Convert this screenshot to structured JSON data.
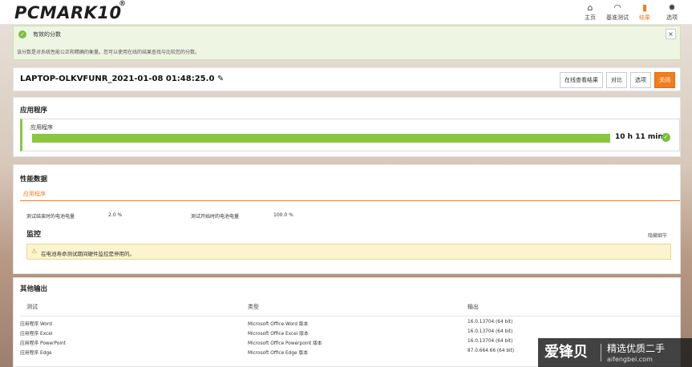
{
  "app": {
    "logo_text": "PCMARK",
    "logo_suffix": "10",
    "logo_sup": "®"
  },
  "nav": [
    {
      "label": "主页",
      "icon": "home-icon",
      "glyph": "⌂"
    },
    {
      "label": "基准测试",
      "icon": "gauge-icon",
      "glyph": "◠"
    },
    {
      "label": "结果",
      "icon": "bar-chart-icon",
      "glyph": "▮",
      "active": true
    },
    {
      "label": "选项",
      "icon": "gear-icon",
      "glyph": "✹"
    }
  ],
  "banner": {
    "title": "有效的分数",
    "description": "该分数是对系统性能公正和精确的衡量。您可以使用在线的结果查找与比较您的分数。",
    "close": "×"
  },
  "run": {
    "name": "LAPTOP-OLKVFUNR_2021-01-08 01:48:25.0",
    "edit_glyph": "✎",
    "buttons": [
      "在线查看结果",
      "对比",
      "选项",
      "关闭"
    ]
  },
  "application": {
    "section_title": "应用程序",
    "score_label": "应用程序",
    "score_value": "10 h 11 min",
    "progress_fraction": 1.0,
    "accent_color": "#8cc63f"
  },
  "performance": {
    "section_title": "性能数据",
    "tab": "应用程序",
    "kv": [
      {
        "label": "测试结束时的电池电量",
        "value": "2.0 %"
      },
      {
        "label": "测试开始时的电池电量",
        "value": "100.0 %"
      }
    ],
    "monitor_title": "监控",
    "hide_details": "隐藏细节",
    "warning_icon": "⚠",
    "warning": "在电池寿命测试期间硬件监控是停用的。"
  },
  "other_output": {
    "section_title": "其他输出",
    "headers": [
      "测试",
      "类型",
      "输出"
    ],
    "rows": [
      [
        "应用程序 Word",
        "Microsoft Office Word 版本",
        "16.0.13704 (64 bit)"
      ],
      [
        "应用程序 Excel",
        "Microsoft Office Excel 版本",
        "16.0.13704 (64 bit)"
      ],
      [
        "应用程序 PowerPoint",
        "Microsoft Office Powerpoint 版本",
        "16.0.13704 (64 bit)"
      ],
      [
        "应用程序 Edge",
        "Microsoft Office Edge 版本",
        "87.0.664.66 (64 bit)"
      ]
    ]
  },
  "watermark": {
    "big": "爱锋贝",
    "small": "精选优质二手",
    "url": "aifengbei.com"
  }
}
